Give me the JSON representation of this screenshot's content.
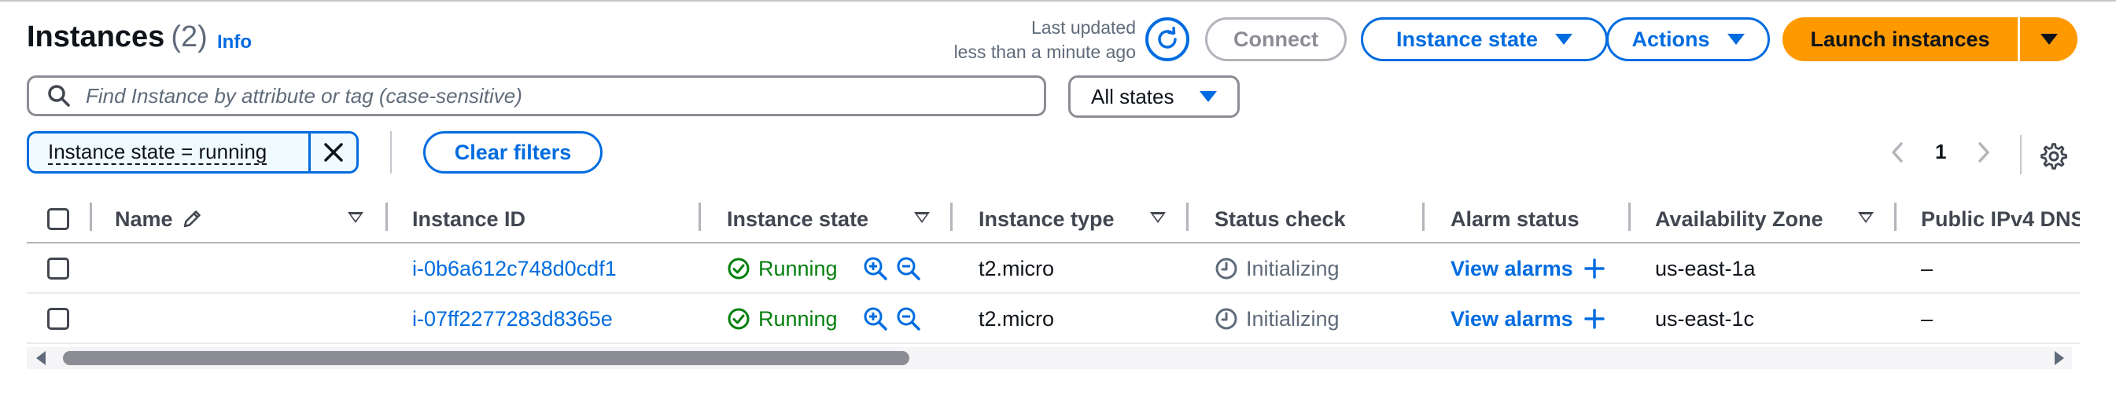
{
  "header": {
    "title": "Instances",
    "count": "(2)",
    "info_link": "Info",
    "last_updated_line1": "Last updated",
    "last_updated_line2": "less than a minute ago"
  },
  "toolbar": {
    "refresh_icon": "refresh-icon",
    "connect_label": "Connect",
    "instance_state_label": "Instance state",
    "actions_label": "Actions",
    "launch_label": "Launch instances"
  },
  "search": {
    "placeholder": "Find Instance by attribute or tag (case-sensitive)",
    "value": ""
  },
  "state_filter": {
    "selected": "All states"
  },
  "filters": {
    "token_label": "Instance state = running",
    "clear_label": "Clear filters"
  },
  "pagination": {
    "current_page": "1"
  },
  "table": {
    "columns": [
      "Name",
      "Instance ID",
      "Instance state",
      "Instance type",
      "Status check",
      "Alarm status",
      "Availability Zone",
      "Public IPv4 DNS"
    ],
    "rows": [
      {
        "name": "",
        "instance_id": "i-0b6a612c748d0cdf1",
        "state": "Running",
        "type": "t2.micro",
        "status_check": "Initializing",
        "alarm": "View alarms",
        "az": "us-east-1a",
        "dns": "–"
      },
      {
        "name": "",
        "instance_id": "i-07ff2277283d8365e",
        "state": "Running",
        "type": "t2.micro",
        "status_check": "Initializing",
        "alarm": "View alarms",
        "az": "us-east-1c",
        "dns": "–"
      }
    ]
  },
  "colors": {
    "primary": "#006ce0",
    "launch": "#ff9900",
    "running": "#037f0c",
    "muted": "#5f6b7a"
  }
}
